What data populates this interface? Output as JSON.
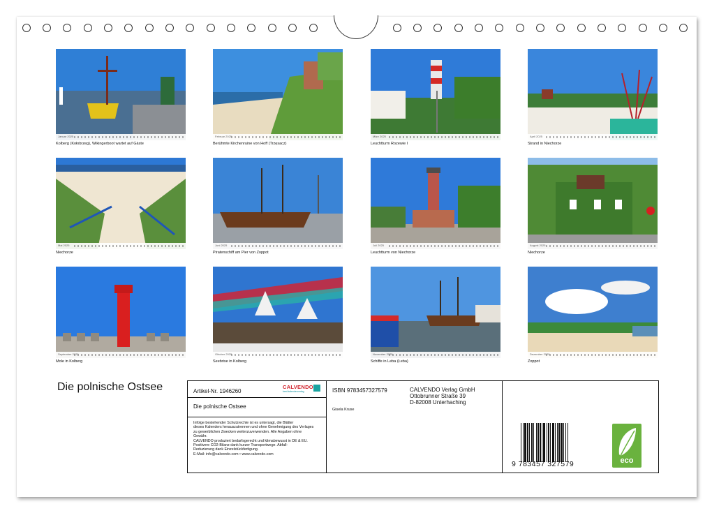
{
  "calendar": {
    "title": "Die polnische Ostsee"
  },
  "photos": [
    {
      "caption": "Kolberg (Kołobrzeg), Wikingerboot wartet auf Gäste",
      "month": "Januar 2025"
    },
    {
      "caption": "Berühmte Kirchenruine von Hoff (Trzęsacz)",
      "month": "Februar 2025"
    },
    {
      "caption": "Leuchtturm Rozewie I",
      "month": "März 2025"
    },
    {
      "caption": "Strand in Niechorze",
      "month": "April 2025"
    },
    {
      "caption": "Niechorze",
      "month": "Mai 2025"
    },
    {
      "caption": "Piratenschiff am Pier von Zoppot",
      "month": "Juni 2025"
    },
    {
      "caption": "Leuchtturm von Niechorze",
      "month": "Juli 2025"
    },
    {
      "caption": "Niechorze",
      "month": "August 2025"
    },
    {
      "caption": "Mole in Kolberg",
      "month": "September 2025"
    },
    {
      "caption": "Seebrise in Kolberg",
      "month": "Oktober 2025"
    },
    {
      "caption": "Schiffe in Leba (Łeba)",
      "month": "November 2025"
    },
    {
      "caption": "Zoppot",
      "month": "Dezember 2025"
    }
  ],
  "info": {
    "article_no": "Artikel-Nr. 1946260",
    "product_title": "Die polnische Ostsee",
    "legal_lines": [
      "Infolge bestehender Schutzrechte ist es untersagt, die Blätter",
      "dieses Kalenders herauszutrennen und ohne Genehmigung des Verlages",
      "zu gewerblichen Zwecken weiterzuverwenden. Alle Angaben ohne",
      "Gewähr.",
      "CALVENDO produziert bedarfsgerecht und klimabewusst in DE & EU.",
      "Positivere CO2-Bilanz dank kurzer Transportwege. Abfall-",
      "Reduzierung dank Einzelstückfertigung.",
      "E-Mail: info@calvendo.com • www.calvendo.com"
    ],
    "isbn": "ISBN 9783457327579",
    "author": "Gisela Kruse",
    "publisher_name": "CALVENDO Verlag GmbH",
    "publisher_street": "Ottobrunner Straße 39",
    "publisher_city": "D-82008 Unterhaching",
    "brand": "CALVENDO",
    "brand_sub": "best.kalenderverlag",
    "barcode_digits": "9 783457 327579",
    "eco_label": "eco"
  }
}
